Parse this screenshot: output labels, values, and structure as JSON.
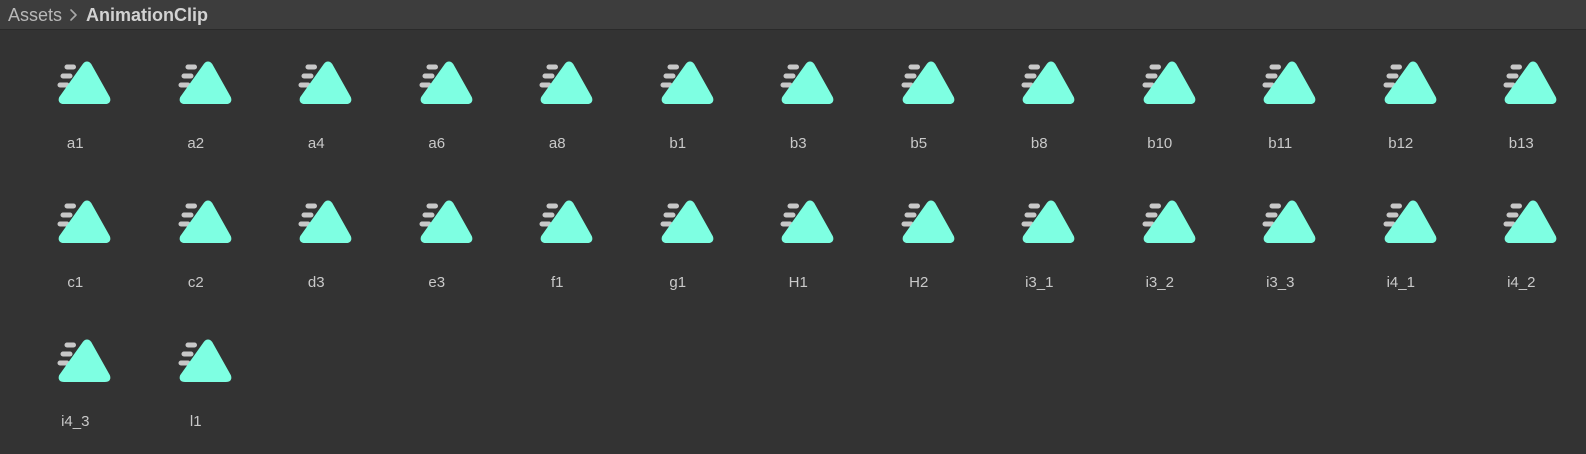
{
  "breadcrumb": {
    "items": [
      "Assets",
      "AnimationClip"
    ],
    "separator_icon": "chevron-right-icon"
  },
  "colors": {
    "background": "#333333",
    "breadcrumb_background": "#3d3d3d",
    "icon_triangle": "#7effe2",
    "icon_motion_lines": "#c8c8c8",
    "label_text": "#c9c9c9"
  },
  "asset_icon": "animation-clip-icon",
  "assets": [
    {
      "name": "a1"
    },
    {
      "name": "a2"
    },
    {
      "name": "a4"
    },
    {
      "name": "a6"
    },
    {
      "name": "a8"
    },
    {
      "name": "b1"
    },
    {
      "name": "b3"
    },
    {
      "name": "b5"
    },
    {
      "name": "b8"
    },
    {
      "name": "b10"
    },
    {
      "name": "b11"
    },
    {
      "name": "b12"
    },
    {
      "name": "b13"
    },
    {
      "name": "c1"
    },
    {
      "name": "c2"
    },
    {
      "name": "d3"
    },
    {
      "name": "e3"
    },
    {
      "name": "f1"
    },
    {
      "name": "g1"
    },
    {
      "name": "H1"
    },
    {
      "name": "H2"
    },
    {
      "name": "i3_1"
    },
    {
      "name": "i3_2"
    },
    {
      "name": "i3_3"
    },
    {
      "name": "i4_1"
    },
    {
      "name": "i4_2"
    },
    {
      "name": "i4_3"
    },
    {
      "name": "l1"
    }
  ]
}
